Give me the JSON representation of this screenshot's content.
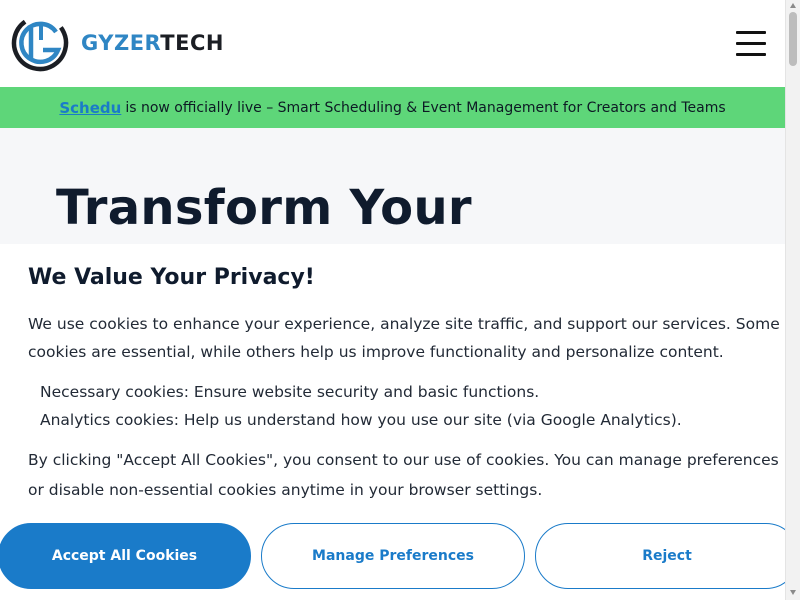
{
  "header": {
    "logo": {
      "icon": "gyzertech-logo-mark",
      "text_part1": "GYZER",
      "text_part2": "TECH",
      "colors": {
        "primary": "#2f86c4",
        "dark": "#1b1e24"
      }
    },
    "menu_icon": "hamburger-menu-icon"
  },
  "announcement": {
    "link_text": "Schedu",
    "text": "is now officially live – Smart Scheduling & Event Management for Creators and Teams",
    "background": "#5ed679"
  },
  "hero": {
    "title": "Transform Your"
  },
  "cookie_banner": {
    "title": "We Value Your Privacy!",
    "intro": "We use cookies to enhance your experience, analyze site traffic, and support our services. Some cookies are essential, while others help us improve functionality and personalize content.",
    "items": [
      {
        "bullet": "",
        "text": "Necessary cookies: Ensure website security and basic functions."
      },
      {
        "bullet": "",
        "text": "Analytics cookies: Help us understand how you use our site (via Google Analytics)."
      }
    ],
    "consent_text": "By clicking \"Accept All Cookies\", you consent to our use of cookies. You can manage preferences or disable non-essential cookies anytime in your browser settings.",
    "buttons": {
      "accept": "Accept All Cookies",
      "manage": "Manage Preferences",
      "reject": "Reject"
    },
    "accent_color": "#1a7bc9"
  }
}
